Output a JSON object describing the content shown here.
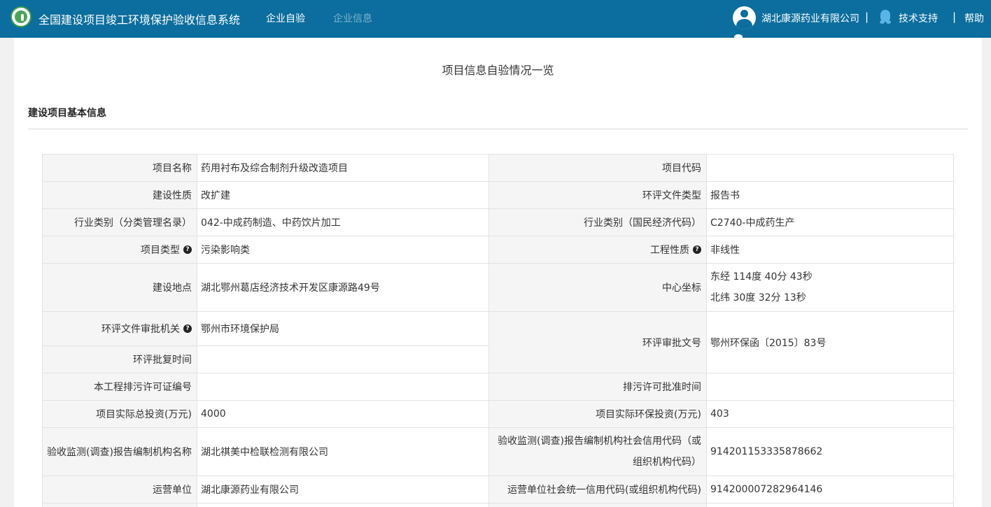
{
  "header": {
    "system_title": "全国建设项目竣工环境保护验收信息系统",
    "nav_self_check": "企业自验",
    "nav_company_info": "企业信息",
    "company_name": "湖北康源药业有限公司",
    "separator": "|",
    "tech_support": "技术支持",
    "help": "帮助"
  },
  "page": {
    "title": "项目信息自验情况一览",
    "section_title": "建设项目基本信息"
  },
  "table": {
    "project_name_label": "项目名称",
    "project_name": "药用衬布及综合制剂升级改造项目",
    "project_code_label": "项目代码",
    "project_code": "",
    "construction_nature_label": "建设性质",
    "construction_nature": "改扩建",
    "eia_doc_type_label": "环评文件类型",
    "eia_doc_type": "报告书",
    "industry_catalog_label": "行业类别（分类管理名录）",
    "industry_catalog": "042-中成药制造、中药饮片加工",
    "industry_national_label": "行业类别（国民经济代码）",
    "industry_national": "C2740-中成药生产",
    "project_type_label": "项目类型",
    "project_type": "污染影响类",
    "engineering_nature_label": "工程性质",
    "engineering_nature": "非线性",
    "location_label": "建设地点",
    "location": "湖北鄂州葛店经济技术开发区康源路49号",
    "center_coord_label": "中心坐标",
    "longitude": "东经 114度 40分 43秒",
    "latitude": "北纬 30度 32分 13秒",
    "approval_authority_label": "环评文件审批机关",
    "approval_authority": "鄂州市环境保护局",
    "approval_doc_no_label": "环评审批文号",
    "approval_doc_no": "鄂州环保函〔2015〕83号",
    "approval_time_label": "环评批复时间",
    "approval_time": "",
    "permit_no_label": "本工程排污许可证编号",
    "permit_no": "",
    "permit_time_label": "排污许可批准时间",
    "permit_time": "",
    "total_investment_label": "项目实际总投资(万元)",
    "total_investment": "4000",
    "env_investment_label": "项目实际环保投资(万元)",
    "env_investment": "403",
    "monitor_org_label": "验收监测(调查)报告编制机构名称",
    "monitor_org": "湖北祺美中检联检测有限公司",
    "monitor_credit_label_line1": "验收监测(调查)报告编制机构社会信用代码（或",
    "monitor_credit_label_line2": "组织机构代码）",
    "monitor_credit": "914201153335878662",
    "operator_label": "运营单位",
    "operator": "湖北康源药业有限公司",
    "operator_credit_label": "运营单位社会统一信用代码(或组织机构代码)",
    "operator_credit": "914200007282964146"
  },
  "icons": {
    "logo": "environmental-protection-logo",
    "avatar": "user-avatar-icon",
    "support": "qq-penguin-icon",
    "question": "question-circle-icon"
  },
  "colors": {
    "header_bg": "#0b6e9e",
    "nav_inactive": "#7fb3cf",
    "label_bg": "#f5f5f5",
    "border": "#e2e2e2"
  }
}
